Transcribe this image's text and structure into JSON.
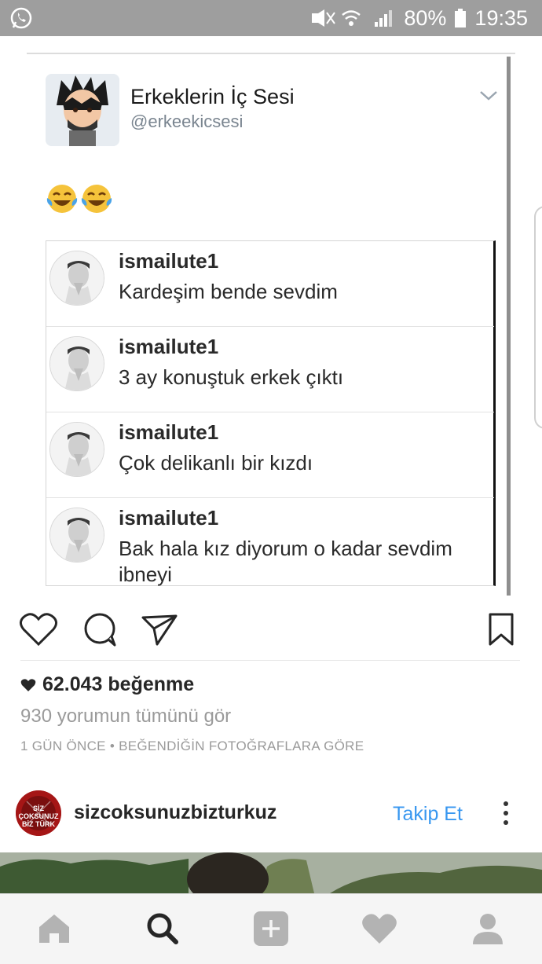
{
  "status_bar": {
    "battery": "80%",
    "time": "19:35",
    "icons": [
      "whatsapp-icon",
      "mute-icon",
      "wifi-icon",
      "signal-icon",
      "battery-icon"
    ]
  },
  "post": {
    "tweet": {
      "name": "Erkeklerin İç Sesi",
      "handle": "@erkeekicsesi",
      "emoji": "😂😂",
      "comments": [
        {
          "user": "ismailute1",
          "text": "Kardeşim bende sevdim"
        },
        {
          "user": "ismailute1",
          "text": "3 ay konuştuk erkek çıktı"
        },
        {
          "user": "ismailute1",
          "text": "Çok delikanlı bir kızdı"
        },
        {
          "user": "ismailute1",
          "text": "Bak hala kız diyorum o kadar sevdim ibneyi"
        }
      ]
    },
    "likes": "62.043 beğenme",
    "view_comments": "930 yorumun tümünü gör",
    "meta": "1 GÜN ÖNCE • BEĞENDİĞİN FOTOĞRAFLARA GÖRE"
  },
  "next_post": {
    "username": "sizcoksunuzbizturkuz",
    "follow_label": "Takip Et",
    "avatar_text": "SİZ ÇOKSUNUZ BİZ TÜRK"
  },
  "colors": {
    "status_bar": "#9e9e9e",
    "follow": "#3897f0",
    "muted_text": "#9a9a9a"
  },
  "bottom_nav": [
    "home-icon",
    "search-icon",
    "add-icon",
    "activity-icon",
    "profile-icon"
  ]
}
